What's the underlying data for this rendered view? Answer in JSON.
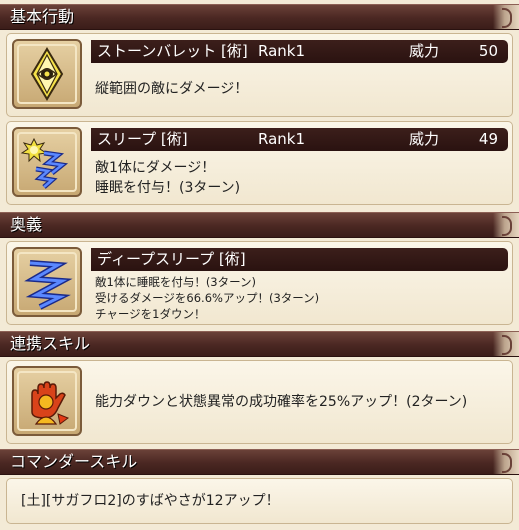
{
  "sections": {
    "basic": {
      "header": "基本行動",
      "cards": [
        {
          "name": "ストーンバレット [術]",
          "rank": "Rank1",
          "power_label": "威力",
          "power_value": "50",
          "icon": "stone-eye-icon",
          "lines": [
            "縦範囲の敵にダメージ！"
          ]
        },
        {
          "name": "スリープ [術]",
          "rank": "Rank1",
          "power_label": "威力",
          "power_value": "49",
          "icon": "sleep-zigzag-icon",
          "lines": [
            "敵1体にダメージ！",
            "睡眠を付与！(3ターン)"
          ]
        }
      ]
    },
    "ougi": {
      "header": "奥義",
      "card": {
        "name": "ディープスリープ [術]",
        "icon": "deep-sleep-icon",
        "lines": [
          "敵1体に睡眠を付与！(3ターン)",
          "受けるダメージを66.6%アップ！(3ターン)",
          "チャージを1ダウン！"
        ]
      }
    },
    "link": {
      "header": "連携スキル",
      "card": {
        "icon": "link-skill-hand-icon",
        "text": "能力ダウンと状態異常の成功確率を25%アップ！(2ターン)"
      }
    },
    "commander": {
      "header": "コマンダースキル",
      "card": {
        "text": "[土][サガフロ2]のすばやさが12アップ！"
      }
    }
  },
  "colors": {
    "header_bg": "#4a2722",
    "title_bar_bg": "#2a1210",
    "card_bg": "#f6efdf",
    "page_bg": "#f3ead6"
  }
}
